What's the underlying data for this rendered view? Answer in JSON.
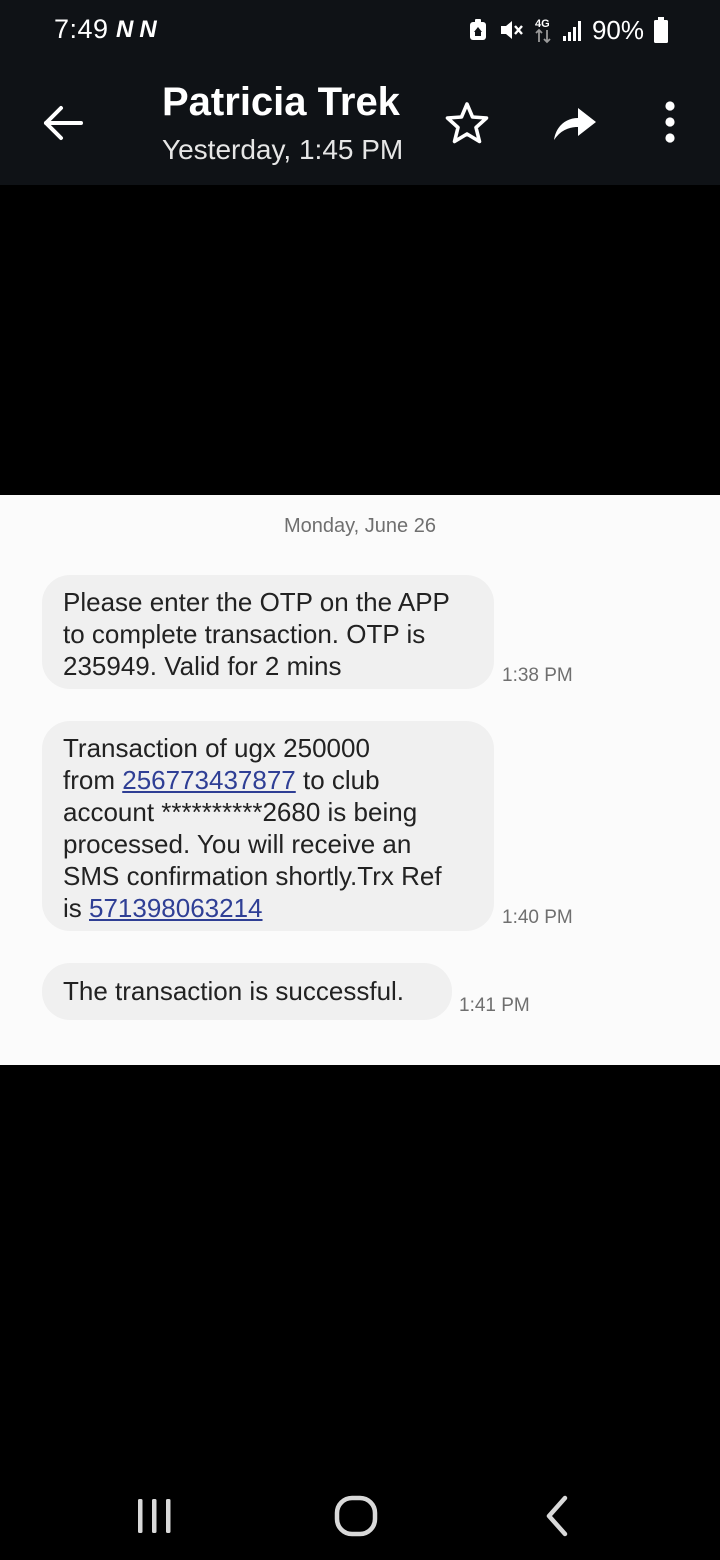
{
  "status_bar": {
    "time": "7:49",
    "notification_icons": [
      "N",
      "N"
    ],
    "network": "4G",
    "battery": "90%"
  },
  "header": {
    "contact_name": "Patricia Trek",
    "subtitle": "Yesterday, 1:45 PM",
    "icons": [
      "back-arrow-icon",
      "star-icon",
      "forward-icon",
      "more-vert-icon"
    ]
  },
  "conversation": {
    "date_divider": "Monday, June 26",
    "messages": [
      {
        "lines": [
          [
            "Please enter the OTP on the APP"
          ],
          [
            "to complete transaction. OTP is"
          ],
          [
            "235949. Valid for 2 mins"
          ]
        ],
        "time": "1:38 PM"
      },
      {
        "line1": "Transaction of ugx 250000",
        "line2_pre": "from ",
        "line2_link": "256773437877",
        "line2_post": " to club",
        "line3": "account **********2680 is being",
        "line4": "processed. You will receive an",
        "line5": "SMS confirmation shortly.Trx Ref",
        "line6_pre": "is ",
        "line6_link": "571398063214",
        "time": "1:40 PM"
      },
      {
        "text": "The transaction is successful.",
        "time": "1:41 PM"
      }
    ]
  },
  "nav_bar": {
    "icons": [
      "recent-apps-icon",
      "home-icon",
      "back-nav-icon"
    ]
  },
  "colors": {
    "header_bg": "#0f1216",
    "panel_bg": "#fbfbfb",
    "bubble_bg": "#f0f0f0",
    "link": "#2f3f95"
  }
}
